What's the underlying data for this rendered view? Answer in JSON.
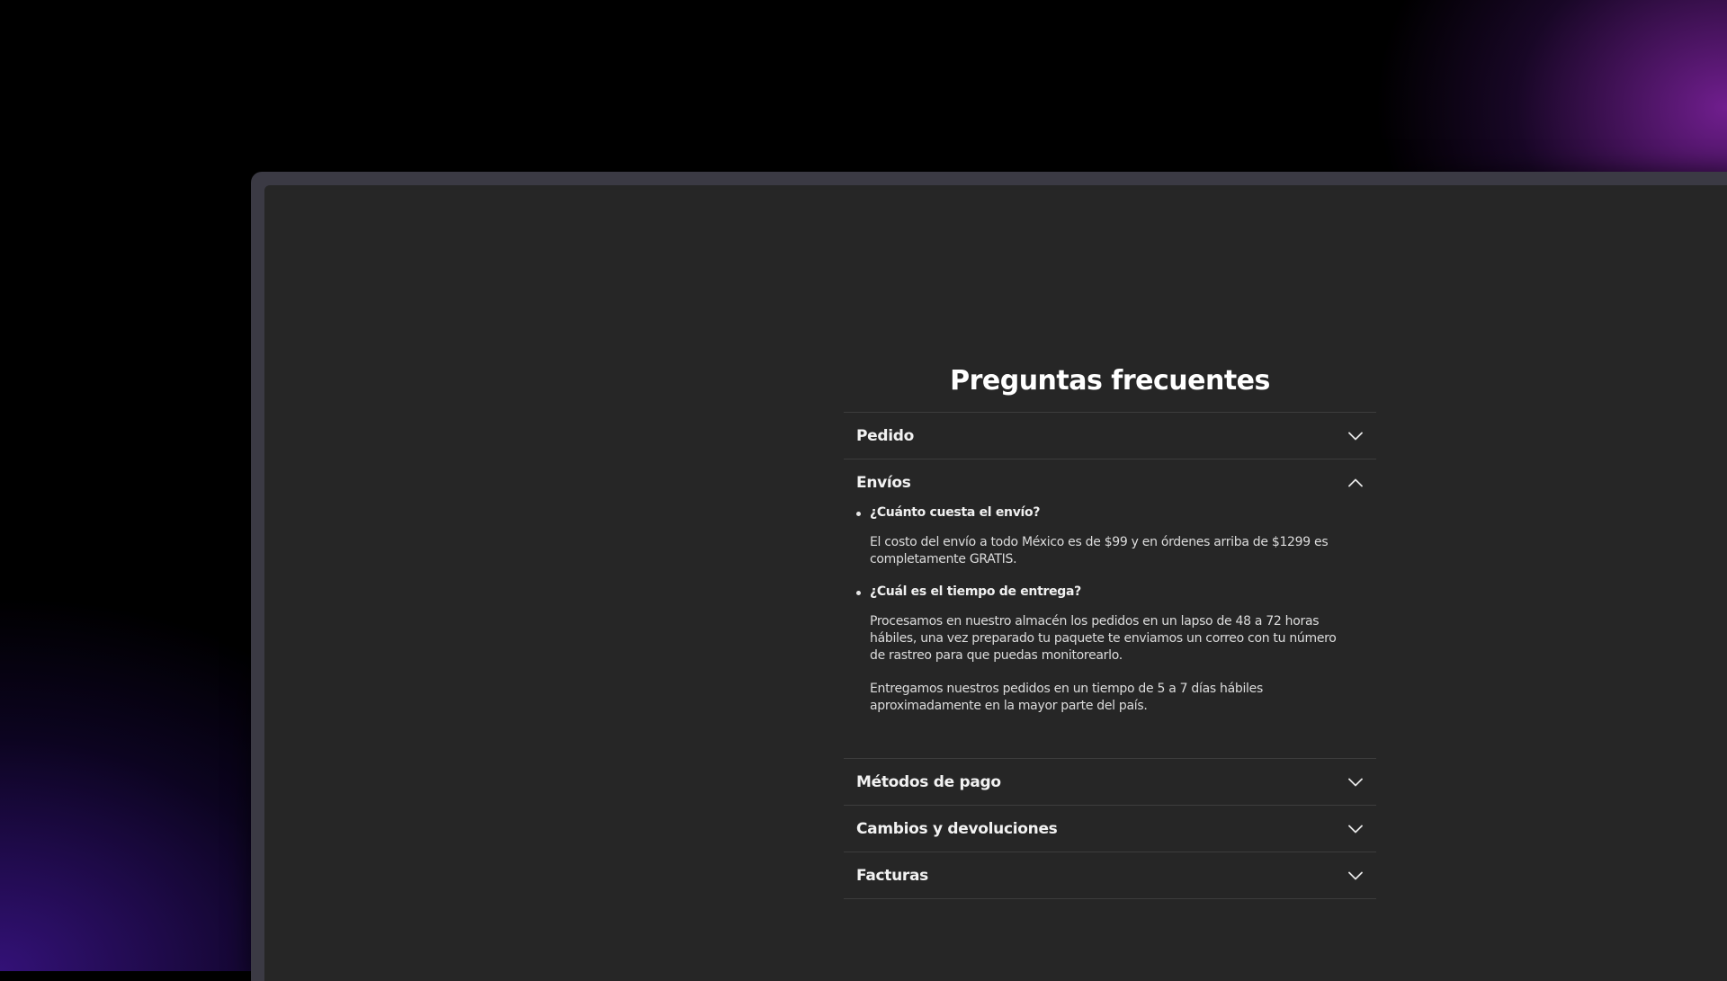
{
  "faq": {
    "title": "Preguntas frecuentes",
    "sections": [
      {
        "label": "Pedido",
        "expanded": false,
        "icon": "chevron-down-icon"
      },
      {
        "label": "Envíos",
        "expanded": true,
        "icon": "chevron-up-icon",
        "questions": [
          {
            "question": "¿Cuánto cuesta el envío?",
            "answers": [
              "El costo del envío a todo México es de $99 y en órdenes arriba de $1299 es completamente GRATIS."
            ]
          },
          {
            "question": "¿Cuál es el tiempo de entrega?",
            "answers": [
              "Procesamos en nuestro almacén los pedidos en un lapso de 48 a 72 horas hábiles, una vez preparado tu paquete te enviamos un correo con tu número de rastreo para que puedas monitorearlo.",
              "Entregamos nuestros pedidos en un tiempo de 5 a 7 días hábiles aproximadamente en la mayor parte del país."
            ]
          }
        ]
      },
      {
        "label": "Métodos de pago",
        "expanded": false,
        "icon": "chevron-down-icon"
      },
      {
        "label": "Cambios y devoluciones",
        "expanded": false,
        "icon": "chevron-down-icon"
      },
      {
        "label": "Facturas",
        "expanded": false,
        "icon": "chevron-down-icon"
      }
    ]
  },
  "colors": {
    "page_bg": "#262626",
    "text": "#ffffff",
    "divider": "#3d3d3d",
    "glow_purple": "#9628be"
  }
}
